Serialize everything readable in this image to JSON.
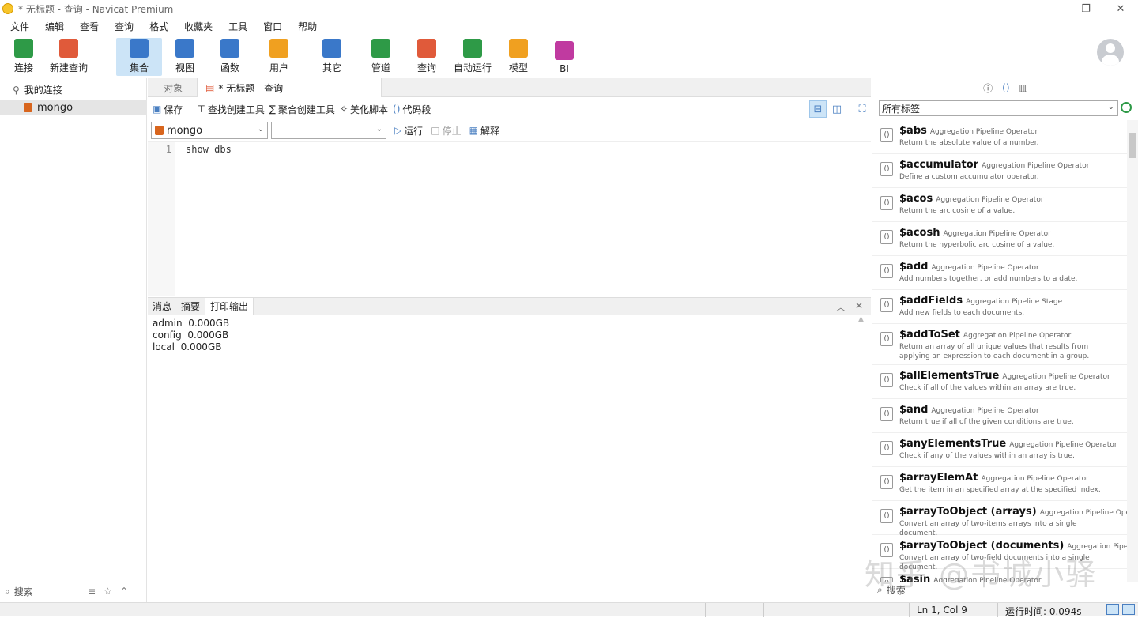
{
  "window": {
    "title": "* 无标题 - 查询 - Navicat Premium",
    "min": "—",
    "max": "❐",
    "close": "✕"
  },
  "menu": [
    "文件",
    "编辑",
    "查看",
    "查询",
    "格式",
    "收藏夹",
    "工具",
    "窗口",
    "帮助"
  ],
  "toolbar": {
    "items": [
      {
        "label": "连接",
        "color": "#2e9a47"
      },
      {
        "label": "新建查询",
        "color": "#e05a3a"
      },
      {
        "label": "集合",
        "color": "#3a78c9"
      },
      {
        "label": "视图",
        "color": "#3a78c9"
      },
      {
        "label": "函数",
        "color": "#3a78c9"
      },
      {
        "label": "用户",
        "color": "#f0a020"
      },
      {
        "label": "其它",
        "color": "#3a78c9"
      },
      {
        "label": "管道",
        "color": "#2e9a47"
      },
      {
        "label": "查询",
        "color": "#e05a3a"
      },
      {
        "label": "自动运行",
        "color": "#2e9a47"
      },
      {
        "label": "模型",
        "color": "#f0a020"
      },
      {
        "label": "BI",
        "color": "#c03aa0"
      }
    ],
    "active": "集合"
  },
  "nav": {
    "root": "我的连接",
    "item": "mongo",
    "search": "搜索"
  },
  "tabs": {
    "objects": "对象",
    "query": "* 无标题 - 查询"
  },
  "query_toolbar": {
    "save": "保存",
    "find": "查找创建工具",
    "aggregate": "聚合创建工具",
    "beautify": "美化脚本",
    "snippet": "代码段"
  },
  "selectors": {
    "connection": "mongo",
    "database": "",
    "run": "运行",
    "stop": "停止",
    "explain": "解释"
  },
  "editor": {
    "line": "1",
    "code": "show dbs"
  },
  "output_tabs": [
    "消息",
    "摘要",
    "打印输出"
  ],
  "output": "admin  0.000GB\nconfig  0.000GB\nlocal  0.000GB",
  "right_panel": {
    "tag_select": "所有标签",
    "search": "搜索"
  },
  "operators": [
    {
      "name": "$abs",
      "type": "Aggregation Pipeline Operator",
      "desc": "Return the absolute value of a number."
    },
    {
      "name": "$accumulator",
      "type": "Aggregation Pipeline Operator",
      "desc": "Define a custom accumulator operator."
    },
    {
      "name": "$acos",
      "type": "Aggregation Pipeline Operator",
      "desc": "Return the arc cosine of a value."
    },
    {
      "name": "$acosh",
      "type": "Aggregation Pipeline Operator",
      "desc": "Return the hyperbolic arc cosine of a value."
    },
    {
      "name": "$add",
      "type": "Aggregation Pipeline Operator",
      "desc": "Add numbers together, or add numbers to a date."
    },
    {
      "name": "$addFields",
      "type": "Aggregation Pipeline Stage",
      "desc": "Add new fields to each documents."
    },
    {
      "name": "$addToSet",
      "type": "Aggregation Pipeline Operator",
      "desc": "Return an array of all unique values that results from applying an expression to each document in a group."
    },
    {
      "name": "$allElementsTrue",
      "type": "Aggregation Pipeline Operator",
      "desc": "Check if all of the values within an array are true."
    },
    {
      "name": "$and",
      "type": "Aggregation Pipeline Operator",
      "desc": "Return true if all of the given conditions are true."
    },
    {
      "name": "$anyElementsTrue",
      "type": "Aggregation Pipeline Operator",
      "desc": "Check if any of the values within an array is true."
    },
    {
      "name": "$arrayElemAt",
      "type": "Aggregation Pipeline Operator",
      "desc": "Get the item in an specified array at the specified index."
    },
    {
      "name": "$arrayToObject (arrays)",
      "type": "Aggregation Pipeline Operator",
      "desc": "Convert an array of two-items arrays into a single document."
    },
    {
      "name": "$arrayToObject (documents)",
      "type": "Aggregation Pipeline Operator",
      "desc": "Convert an array of two-field documents into a single document."
    },
    {
      "name": "$asin",
      "type": "Aggregation Pipeline Operator",
      "desc": ""
    }
  ],
  "watermark": "知乎 @书城小驿",
  "status": {
    "position": "Ln 1, Col 9",
    "runtime": "运行时间: 0.094s"
  }
}
